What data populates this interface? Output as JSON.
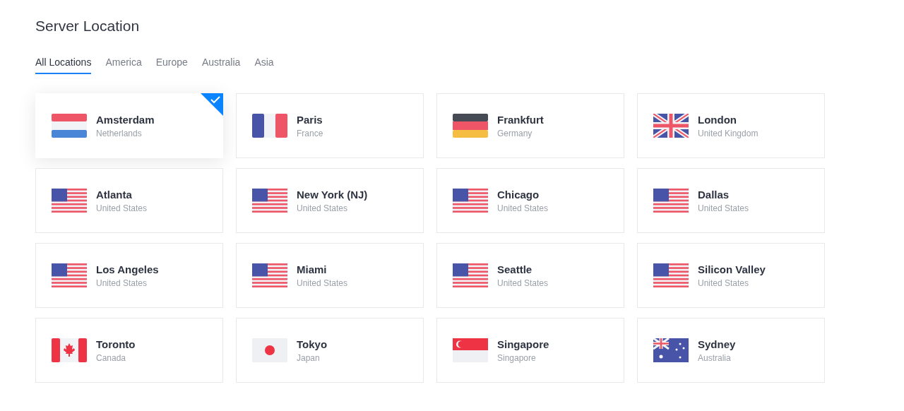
{
  "title": "Server Location",
  "tabs": [
    {
      "label": "All Locations",
      "selected": true
    },
    {
      "label": "America",
      "selected": false
    },
    {
      "label": "Europe",
      "selected": false
    },
    {
      "label": "Australia",
      "selected": false
    },
    {
      "label": "Asia",
      "selected": false
    }
  ],
  "locations": [
    {
      "city": "Amsterdam",
      "country": "Netherlands",
      "kind": "nl",
      "selected": true
    },
    {
      "city": "Paris",
      "country": "France",
      "kind": "fr",
      "selected": false
    },
    {
      "city": "Frankfurt",
      "country": "Germany",
      "kind": "de",
      "selected": false
    },
    {
      "city": "London",
      "country": "United Kingdom",
      "kind": "gb",
      "selected": false
    },
    {
      "city": "Atlanta",
      "country": "United States",
      "kind": "us",
      "selected": false
    },
    {
      "city": "New York (NJ)",
      "country": "United States",
      "kind": "us",
      "selected": false
    },
    {
      "city": "Chicago",
      "country": "United States",
      "kind": "us",
      "selected": false
    },
    {
      "city": "Dallas",
      "country": "United States",
      "kind": "us",
      "selected": false
    },
    {
      "city": "Los Angeles",
      "country": "United States",
      "kind": "us",
      "selected": false
    },
    {
      "city": "Miami",
      "country": "United States",
      "kind": "us",
      "selected": false
    },
    {
      "city": "Seattle",
      "country": "United States",
      "kind": "us",
      "selected": false
    },
    {
      "city": "Silicon Valley",
      "country": "United States",
      "kind": "us",
      "selected": false
    },
    {
      "city": "Toronto",
      "country": "Canada",
      "kind": "ca",
      "selected": false
    },
    {
      "city": "Tokyo",
      "country": "Japan",
      "kind": "jp",
      "selected": false
    },
    {
      "city": "Singapore",
      "country": "Singapore",
      "kind": "sg",
      "selected": false
    },
    {
      "city": "Sydney",
      "country": "Australia",
      "kind": "au",
      "selected": false
    }
  ]
}
